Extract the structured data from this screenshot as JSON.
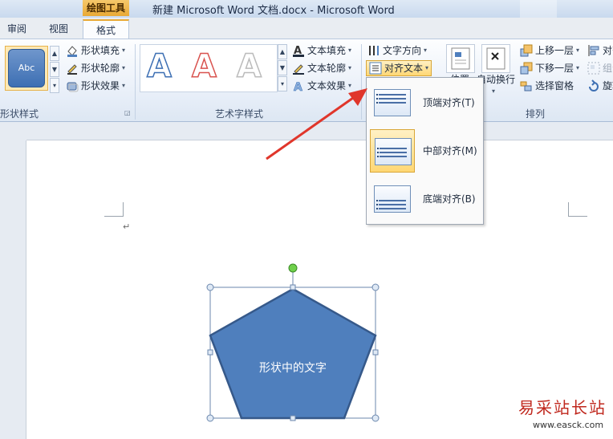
{
  "window": {
    "title": "新建 Microsoft Word 文档.docx  -  Microsoft Word",
    "context_tab_header": "绘图工具"
  },
  "tabs": [
    {
      "label": "审阅"
    },
    {
      "label": "视图"
    },
    {
      "label": "格式",
      "active": true
    }
  ],
  "ribbon": {
    "shape_styles": {
      "sample_label": "Abc",
      "fill": "形状填充",
      "outline": "形状轮廓",
      "effects": "形状效果",
      "group_label": "形状样式"
    },
    "wordart": {
      "samples": [
        "A",
        "A",
        "A"
      ],
      "text_fill": "文本填充",
      "text_outline": "文本轮廓",
      "text_effects": "文本效果",
      "group_label": "艺术字样式"
    },
    "text": {
      "direction": "文字方向",
      "align_text": "对齐文本"
    },
    "arrange": {
      "position": "位置",
      "wrap_text": "自动换行",
      "bring_forward": "上移一层",
      "send_backward": "下移一层",
      "selection_pane": "选择窗格",
      "align": "对齐",
      "group": "组合",
      "rotate": "旋转",
      "group_label": "排列"
    }
  },
  "align_menu": {
    "items": [
      {
        "label": "顶端对齐(T)",
        "hotkey": "T"
      },
      {
        "label": "中部对齐(M)",
        "hotkey": "M",
        "selected": true
      },
      {
        "label": "底端对齐(B)",
        "hotkey": "B"
      }
    ]
  },
  "document": {
    "paragraph_mark": "↵",
    "shape_text": "形状中的文字"
  },
  "watermark": {
    "name": "易采站长站",
    "url": "www.easck.com"
  },
  "colors": {
    "shape_fill": "#4f7fbd",
    "shape_stroke": "#36598a",
    "accent": "#e9a935",
    "arrow": "#e0362b"
  }
}
